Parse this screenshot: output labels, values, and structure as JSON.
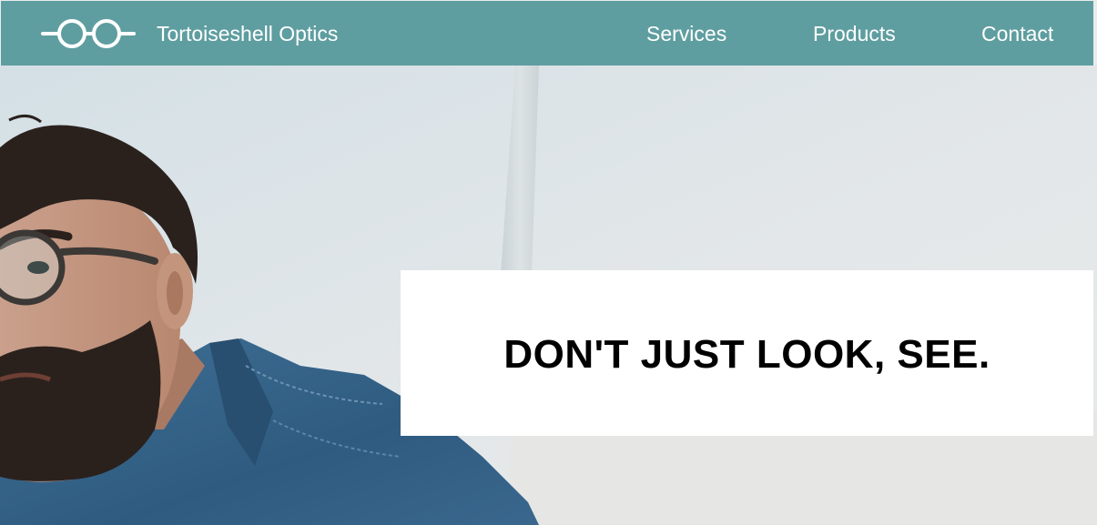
{
  "header": {
    "brand": "Tortoiseshell Optics",
    "logo_icon": "eyeglasses-icon",
    "nav": [
      {
        "label": "Services"
      },
      {
        "label": "Products"
      },
      {
        "label": "Contact"
      }
    ]
  },
  "hero": {
    "image": "man-with-glasses-photo",
    "tagline": "DON'T JUST LOOK, SEE."
  },
  "colors": {
    "navbar": "#5f9ea0",
    "nav_text": "#ffffff",
    "tagline_box": "#ffffff",
    "tagline_text": "#000000"
  }
}
